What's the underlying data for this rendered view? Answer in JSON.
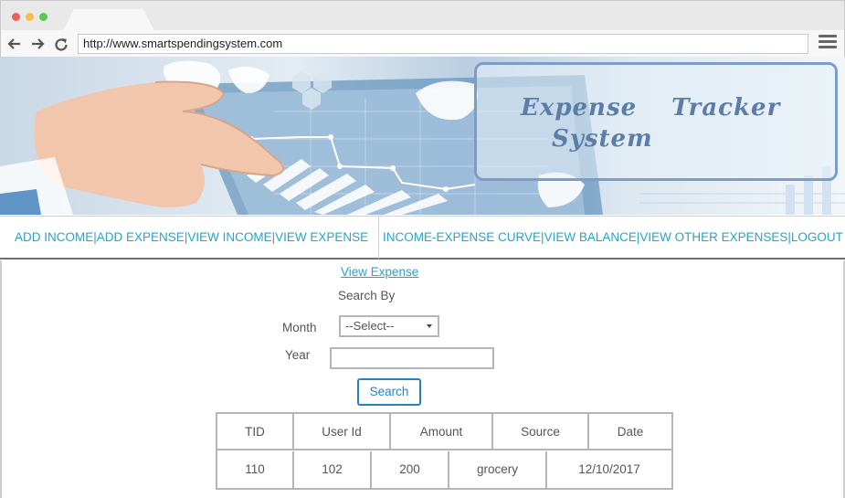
{
  "browser": {
    "url": "http://www.smartspendingsystem.com"
  },
  "banner": {
    "title_line1": "Expense  Tracker",
    "title_line2": "System"
  },
  "nav": {
    "left": [
      "ADD INCOME",
      "ADD EXPENSE",
      "VIEW INCOME",
      "VIEW EXPENSE"
    ],
    "right": [
      "INCOME-EXPENSE CURVE",
      "VIEW BALANCE",
      "VIEW OTHER EXPENSES",
      "LOGOUT"
    ],
    "separator": "|"
  },
  "main": {
    "page_title": "View Expense",
    "search_by": "Search By",
    "month_label": "Month",
    "month_value": "--Select--",
    "year_label": "Year",
    "year_value": "",
    "search_button": "Search"
  },
  "table": {
    "headers": [
      "TID",
      "User Id",
      "Amount",
      "Source",
      "Date"
    ],
    "rows": [
      [
        "110",
        "102",
        "200",
        "grocery",
        "12/10/2017"
      ]
    ]
  },
  "colors": {
    "link": "#27a3c9",
    "button": "#2a7fc0",
    "title": "#5b7da8"
  },
  "icons": [
    "back-arrow-icon",
    "forward-arrow-icon",
    "reload-icon",
    "hamburger-menu-icon"
  ]
}
